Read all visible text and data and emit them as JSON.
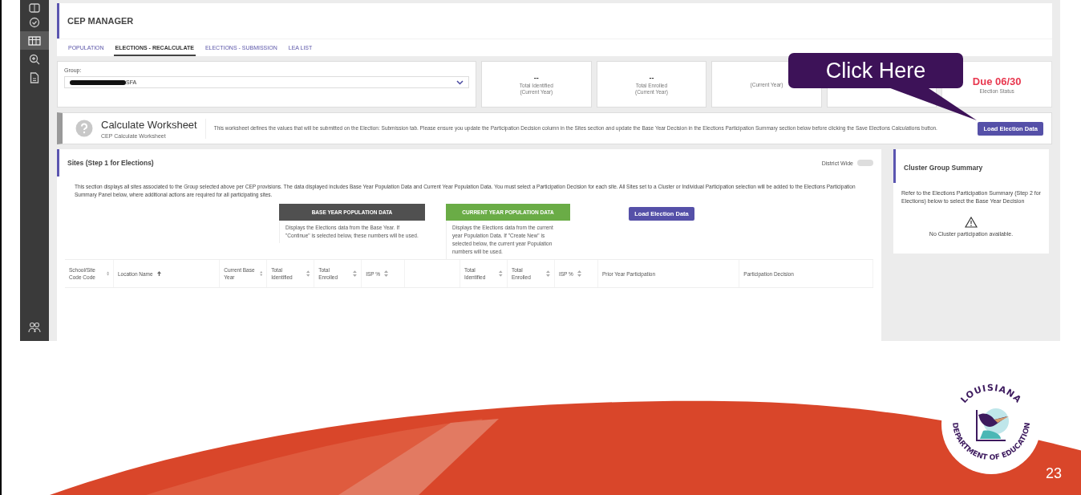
{
  "sidebar": {
    "items": [
      {
        "kind": "grid",
        "selected": false
      },
      {
        "kind": "check",
        "selected": false
      },
      {
        "kind": "table",
        "selected": true
      },
      {
        "kind": "zoom",
        "selected": false
      },
      {
        "kind": "document",
        "selected": false
      },
      {
        "kind": "people",
        "selected": false
      }
    ]
  },
  "header": {
    "title": "CEP MANAGER"
  },
  "tabs": [
    {
      "label": "POPULATION",
      "selected": false
    },
    {
      "label": "ELECTIONS - RECALCULATE",
      "selected": true
    },
    {
      "label": "ELECTIONS - SUBMISSION",
      "selected": false
    },
    {
      "label": "LEA LIST",
      "selected": false
    }
  ],
  "group": {
    "label": "Group:",
    "value": "SFA",
    "redacted": true
  },
  "stats": [
    {
      "value": "--",
      "label": "Total Identified",
      "sub": "(Current Year)",
      "kind": "plain"
    },
    {
      "value": "--",
      "label": "Total Enrolled",
      "sub": "(Current Year)",
      "kind": "plain"
    },
    {
      "sub": "(Current Year)",
      "kind": "plain"
    },
    {
      "kind": "plain"
    },
    {
      "value": "Due 06/30",
      "label": "Election Status",
      "kind": "alert"
    }
  ],
  "callout": {
    "text": "Click Here"
  },
  "worksheet": {
    "title": "Calculate Worksheet",
    "subtitle": "CEP Calculate Worksheet",
    "description": "This worksheet defines the values that will be submitted on the Election: Submission tab. Please ensure you update the Participation Decision column in the Sites section and update the Base Year Decision in the Elections Participation Summary section below before clicking the Save Elections Calculations button.",
    "button": "Load Election Data"
  },
  "sites": {
    "title": "Sites (Step 1 for Elections)",
    "toggle": {
      "label": "District Wide",
      "on": false
    },
    "description": "This section displays all sites associated to the Group selected above per CEP provisions. The data displayed includes Base Year Population Data and Current Year Population Data. You must select a Participation Decision for each site. All Sites set to a Cluster or Individual Participation selection will be added to the Elections Participation Summary Panel below, where additional actions are required for all participating sites.",
    "groups": [
      {
        "title": "BASE YEAR POPULATION DATA",
        "text": "Displays the Elections data from the Base Year. If \"Continue\" is selected below, these numbers will be used.",
        "color": "#505050"
      },
      {
        "title": "CURRENT YEAR POPULATION DATA",
        "text": "Displays the Elections data from the current year Population Data. If \"Create New\" is selected below, the current year Population numbers will be used.",
        "color": "#6aac46"
      }
    ],
    "button": "Load Election Data",
    "columns": [
      {
        "label": "School/Site Code Code",
        "kind": "sortable"
      },
      {
        "label": "Location Name",
        "kind": "ascending"
      },
      {
        "label": "Current Base Year",
        "kind": "sortable"
      },
      {
        "label": "Total Identified",
        "kind": "sortable"
      },
      {
        "label": "Total Enrolled",
        "kind": "sortable"
      },
      {
        "label": "ISP %",
        "kind": "sortable"
      },
      {
        "label": "Total Identified",
        "kind": "sortable"
      },
      {
        "label": "Total Enrolled",
        "kind": "sortable"
      },
      {
        "label": "ISP %",
        "kind": "sortable"
      },
      {
        "label": "Prior Year Participation",
        "kind": "plain"
      },
      {
        "label": "Participation Decision",
        "kind": "plain"
      }
    ]
  },
  "cluster": {
    "title": "Cluster Group Summary",
    "text": "Refer to the Elections Participation Summary (Step 2 for Elections) below to select the Base Year Decision",
    "empty": "No Cluster participation available."
  },
  "slide": {
    "seal_top": "LOUISIANA",
    "seal_bottom": "DEPARTMENT OF EDUCATION",
    "page": "23"
  }
}
